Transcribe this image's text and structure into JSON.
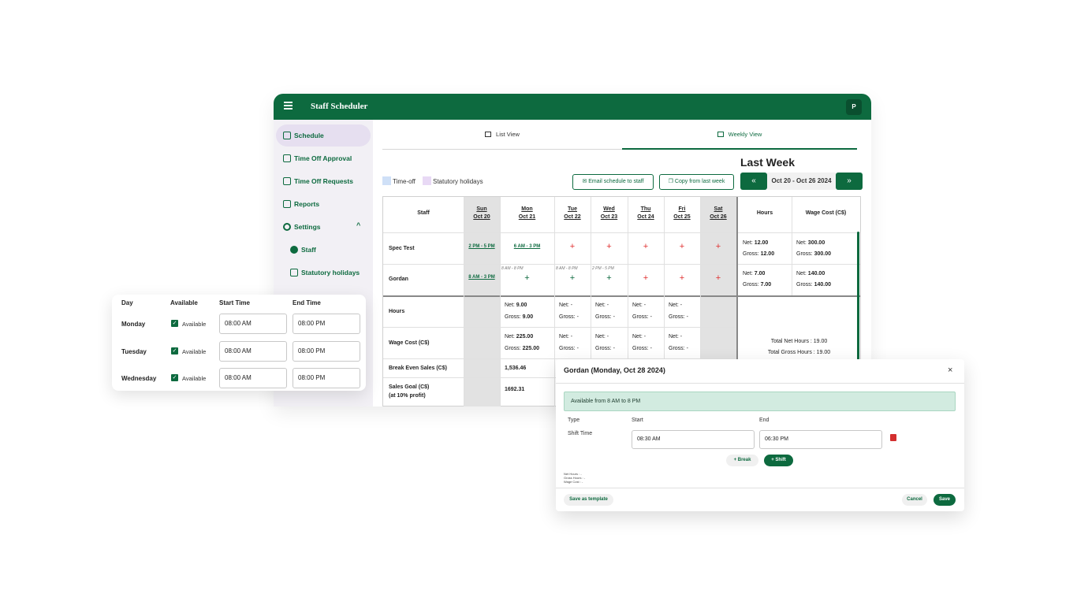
{
  "app": {
    "title": "Staff Scheduler",
    "avatar": "P"
  },
  "colors": {
    "brand": "#0d6a3f",
    "timeoff": "#cfe0f7",
    "statutory": "#e8d9f5",
    "add_shift": "#e03030"
  },
  "sidebar": {
    "items": [
      {
        "label": "Schedule",
        "icon": "calendar-clock-icon"
      },
      {
        "label": "Time Off Approval",
        "icon": "calendar-check-icon"
      },
      {
        "label": "Time Off Requests",
        "icon": "calendar-icon"
      },
      {
        "label": "Reports",
        "icon": "report-icon"
      },
      {
        "label": "Settings",
        "icon": "gear-icon",
        "chevron": "^"
      },
      {
        "label": "Staff",
        "icon": "user-icon"
      },
      {
        "label": "Statutory holidays",
        "icon": "calendar-icon"
      }
    ]
  },
  "tabs": {
    "list": "List View",
    "weekly": "Weekly View"
  },
  "legend": {
    "timeoff": "Time-off",
    "statutory": "Statutory holidays"
  },
  "toolbar": {
    "email": "Email schedule to staff",
    "copy": "Copy from last week",
    "heading": "Last Week",
    "prev": "«",
    "next": "»",
    "date_range": "Oct 20 - Oct 26 2024"
  },
  "schedule": {
    "staff_header": "Staff",
    "hours_header": "Hours",
    "wage_header": "Wage Cost (C$)",
    "days": [
      {
        "name": "Sun",
        "date": "Oct 20"
      },
      {
        "name": "Mon",
        "date": "Oct 21"
      },
      {
        "name": "Tue",
        "date": "Oct 22"
      },
      {
        "name": "Wed",
        "date": "Oct 23"
      },
      {
        "name": "Thu",
        "date": "Oct 24"
      },
      {
        "name": "Fri",
        "date": "Oct 25"
      },
      {
        "name": "Sat",
        "date": "Oct 26"
      }
    ],
    "rows": [
      {
        "name": "Spec Test",
        "shifts": [
          "2 PM - 5 PM",
          "6 AM - 3 PM",
          "+",
          "+",
          "+",
          "+",
          "+"
        ],
        "hours_net": "12.00",
        "hours_gross": "12.00",
        "wage_net": "300.00",
        "wage_gross": "300.00"
      },
      {
        "name": "Gordan",
        "shifts": [
          "8 AM - 3 PM",
          "+",
          "+",
          "+",
          "+",
          "+",
          "+"
        ],
        "availability": [
          "",
          "8 AM - 8 PM",
          "8 AM - 8 PM",
          "2 PM - 5 PM",
          "",
          "",
          ""
        ],
        "hours_net": "7.00",
        "hours_gross": "7.00",
        "wage_net": "140.00",
        "wage_gross": "140.00"
      }
    ],
    "summary": {
      "hours_label": "Hours",
      "wage_label": "Wage Cost (C$)",
      "break_even_label": "Break Even Sales (C$)",
      "sales_goal_label": "Sales Goal (C$)",
      "sales_goal_sub": "(at 10% profit)",
      "mon_hours_net": "9.00",
      "mon_hours_gross": "9.00",
      "mon_wage_net": "225.00",
      "mon_wage_gross": "225.00",
      "mon_break_even": "1,536.46",
      "mon_sales_goal": "1692.31",
      "dash": "-",
      "net_label": "Net:",
      "gross_label": "Gross:",
      "total_net": "Total Net Hours : 19.00",
      "total_gross": "Total Gross Hours : 19.00"
    }
  },
  "availability": {
    "headers": {
      "day": "Day",
      "available": "Available",
      "start": "Start Time",
      "end": "End Time"
    },
    "rows": [
      {
        "day": "Monday",
        "label": "Available",
        "start": "08:00 AM",
        "end": "08:00 PM"
      },
      {
        "day": "Tuesday",
        "label": "Available",
        "start": "08:00 AM",
        "end": "08:00 PM"
      },
      {
        "day": "Wednesday",
        "label": "Available",
        "start": "08:00 AM",
        "end": "08:00 PM"
      }
    ]
  },
  "dialog": {
    "title": "Gordan (Monday, Oct 28 2024)",
    "close": "×",
    "alert": "Available from 8 AM to 8 PM",
    "type_label": "Type",
    "start_label": "Start",
    "end_label": "End",
    "shift_type": "Shift Time",
    "start_value": "08:30 AM",
    "end_value": "06:30 PM",
    "break_btn": "+ Break",
    "shift_btn": "+ Shift",
    "net_hours": "Net Hours : -",
    "gross_hours": "Gross Hours : -",
    "wage_cost": "Wage Cost : -",
    "save_template": "Save as template",
    "cancel": "Cancel",
    "save": "Save"
  }
}
